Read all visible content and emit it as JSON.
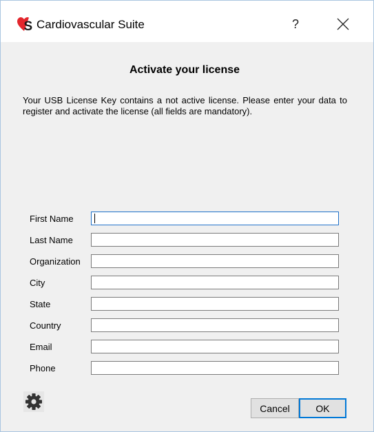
{
  "window": {
    "title": "Cardiovascular Suite",
    "help_label": "?",
    "colors": {
      "logo_red": "#e3262c",
      "focus_blue": "#0078d7"
    }
  },
  "dialog": {
    "heading": "Activate your license",
    "description": "Your USB License Key contains a not active license. Please enter your data to register and activate the license (all fields are mandatory).",
    "fields": [
      {
        "label": "First Name",
        "value": ""
      },
      {
        "label": "Last Name",
        "value": ""
      },
      {
        "label": "Organization",
        "value": ""
      },
      {
        "label": "City",
        "value": ""
      },
      {
        "label": "State",
        "value": ""
      },
      {
        "label": "Country",
        "value": ""
      },
      {
        "label": "Email",
        "value": ""
      },
      {
        "label": "Phone",
        "value": ""
      }
    ],
    "buttons": {
      "cancel": "Cancel",
      "ok": "OK"
    },
    "icons": {
      "settings": "gear-icon"
    }
  }
}
